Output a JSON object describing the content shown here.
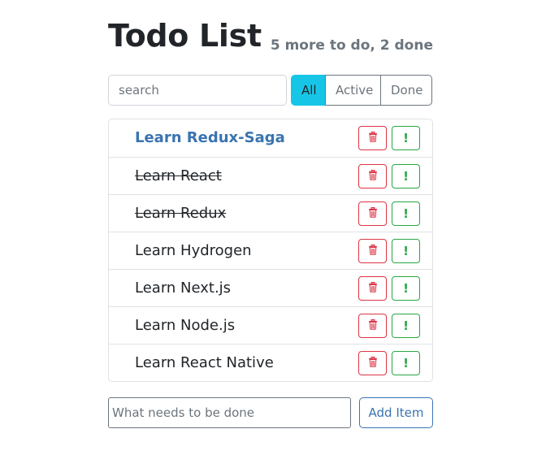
{
  "header": {
    "title": "Todo List",
    "counts": "5 more to do, 2 done"
  },
  "search": {
    "placeholder": "search",
    "value": ""
  },
  "filters": [
    {
      "label": "All",
      "active": true
    },
    {
      "label": "Active",
      "active": false
    },
    {
      "label": "Done",
      "active": false
    }
  ],
  "todos": [
    {
      "label": "Learn Redux-Saga",
      "important": true,
      "done": false
    },
    {
      "label": "Learn React",
      "important": false,
      "done": true
    },
    {
      "label": "Learn Redux",
      "important": false,
      "done": true
    },
    {
      "label": "Learn Hydrogen",
      "important": false,
      "done": false
    },
    {
      "label": "Learn Next.js",
      "important": false,
      "done": false
    },
    {
      "label": "Learn Node.js",
      "important": false,
      "done": false
    },
    {
      "label": "Learn React Native",
      "important": false,
      "done": false
    }
  ],
  "item_buttons": {
    "delete_icon": "trash-icon",
    "important_label": "!"
  },
  "add_form": {
    "placeholder": "What needs to be done",
    "button_label": "Add Item"
  },
  "colors": {
    "accent": "#17c6e6",
    "important_text": "#3a74b0",
    "danger": "#dc3545",
    "success": "#28a745"
  }
}
